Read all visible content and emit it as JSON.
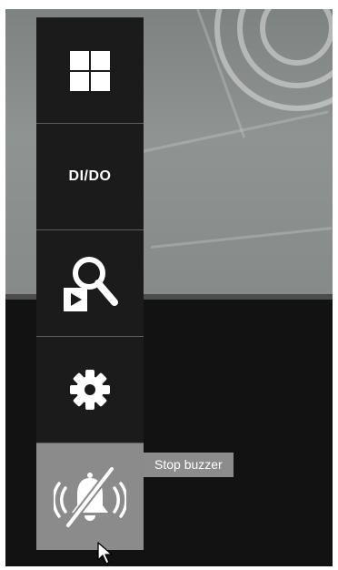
{
  "toolbar": {
    "items": [
      {
        "name": "layout",
        "icon": "grid-layout-icon"
      },
      {
        "name": "dido",
        "label": "DI/DO"
      },
      {
        "name": "search-playback",
        "icon": "search-playback-icon"
      },
      {
        "name": "settings",
        "icon": "gear-icon"
      },
      {
        "name": "stop-buzzer",
        "icon": "muted-alarm-bell-icon",
        "active": true
      }
    ]
  },
  "tooltip": {
    "text": "Stop buzzer"
  },
  "colors": {
    "toolbar_bg": "#1b1b1b",
    "active_bg": "#8b8b8b",
    "tooltip_bg": "#8c8c8c",
    "viewport_bg": "#121212"
  }
}
